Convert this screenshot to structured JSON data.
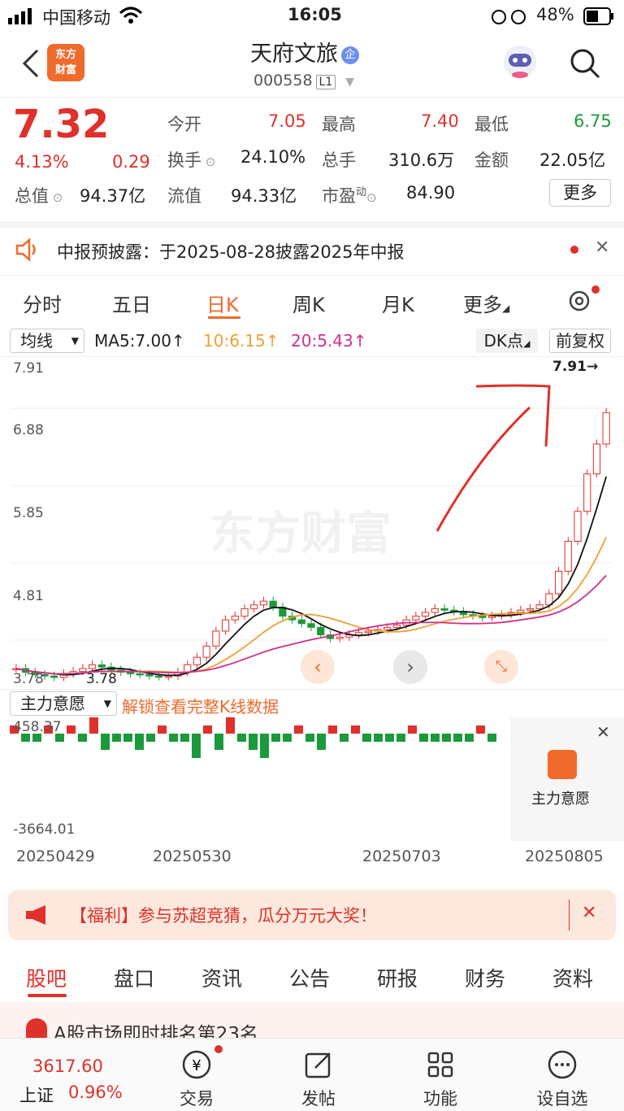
{
  "status": {
    "carrier": "中国移动",
    "time": "16:05",
    "battery": "48%"
  },
  "header": {
    "logo_line1": "东方",
    "logo_line2": "财富",
    "title": "天府文旅",
    "badge": "企",
    "code": "000558",
    "level": "L1"
  },
  "quote": {
    "price": "7.32",
    "change_pct": "4.13%",
    "change": "0.29",
    "open_label": "今开",
    "open": "7.05",
    "high_label": "最高",
    "high": "7.40",
    "low_label": "最低",
    "low": "6.75",
    "turnover_label": "换手",
    "turnover": "24.10%",
    "volume_label": "总手",
    "volume": "310.6万",
    "amount_label": "金额",
    "amount": "22.05亿",
    "total_cap_label": "总值",
    "total_cap": "94.37亿",
    "float_cap_label": "流值",
    "float_cap": "94.33亿",
    "pe_label": "市盈",
    "pe_sup": "动",
    "pe": "84.90",
    "more": "更多"
  },
  "notice": {
    "text": "中报预披露：于2025-08-28披露2025年中报"
  },
  "tabs": [
    "分时",
    "五日",
    "日K",
    "周K",
    "月K",
    "更多"
  ],
  "mabar": {
    "selector": "均线",
    "ma5": "MA5:7.00↑",
    "ma10": "10:6.15↑",
    "ma20": "20:5.43↑",
    "dk": "DK点",
    "adjust": "前复权"
  },
  "chart": {
    "y_ticks": [
      "7.91",
      "6.88",
      "5.85",
      "4.81",
      "3.78"
    ],
    "high_marker": "7.91→",
    "low_marker": "3.78",
    "watermark": "东方财富",
    "colors": {
      "up": "#e0302a",
      "down": "#1a9a3a",
      "ma5": "#111111",
      "ma10": "#f0a030",
      "ma20": "#d0308a"
    }
  },
  "chart_data": {
    "type": "candlestick",
    "ylim": [
      3.78,
      7.91
    ],
    "candles_close": [
      3.9,
      3.85,
      3.82,
      3.8,
      3.78,
      3.83,
      3.86,
      3.9,
      3.95,
      3.92,
      3.88,
      3.85,
      3.83,
      3.82,
      3.8,
      3.79,
      3.8,
      3.85,
      3.95,
      4.05,
      4.2,
      4.4,
      4.55,
      4.6,
      4.7,
      4.75,
      4.8,
      4.72,
      4.6,
      4.55,
      4.5,
      4.45,
      4.35,
      4.3,
      4.32,
      4.35,
      4.38,
      4.4,
      4.42,
      4.45,
      4.48,
      4.55,
      4.6,
      4.65,
      4.7,
      4.68,
      4.66,
      4.62,
      4.6,
      4.58,
      4.6,
      4.62,
      4.65,
      4.68,
      4.7,
      4.75,
      4.9,
      5.2,
      5.6,
      6.0,
      6.5,
      6.9,
      7.32
    ]
  },
  "indicator": {
    "selector": "主力意愿",
    "unlock": "解锁查看完整K线数据",
    "max": "458.37",
    "min": "-3664.01",
    "panel_label": "主力意愿"
  },
  "dates": [
    "20250429",
    "20250530",
    "20250703",
    "20250805"
  ],
  "banner": {
    "text": "【福利】参与苏超竞猜，瓜分万元大奖！"
  },
  "bottom_tabs": [
    "股吧",
    "盘口",
    "资讯",
    "公告",
    "研报",
    "财务",
    "资料"
  ],
  "rank": {
    "text": "A股市场即时排名第23名"
  },
  "bottomnav": {
    "index_value": "3617.60",
    "index_name": "上证",
    "index_pct": "0.96%",
    "items": [
      "交易",
      "发帖",
      "功能",
      "设自选"
    ]
  }
}
